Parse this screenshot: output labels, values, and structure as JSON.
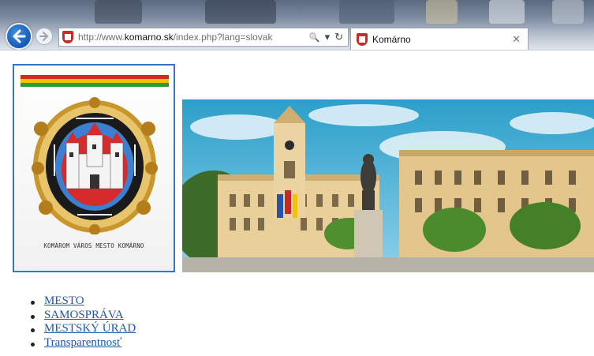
{
  "browser": {
    "url_prefix": "http://www.",
    "url_domain": "komarno.sk",
    "url_path": "/index.php?lang=slovak",
    "search_icon": "🔍",
    "dropdown_icon": "▾",
    "refresh_icon": "↻",
    "tab_title": "Komárno",
    "tab_close": "✕"
  },
  "logo": {
    "caption": "KOMÁROM VÁROS   MESTO KOMÁRNO",
    "flag_colors": [
      "#d22a1d",
      "#f2c200",
      "#2e9b3a"
    ]
  },
  "nav": {
    "items": [
      "MESTO",
      "SAMOSPRÁVA",
      "MESTSKÝ ÚRAD",
      "Transparentnosť"
    ]
  },
  "colors": {
    "link": "#1d58a8",
    "box_border": "#3a73c4"
  }
}
